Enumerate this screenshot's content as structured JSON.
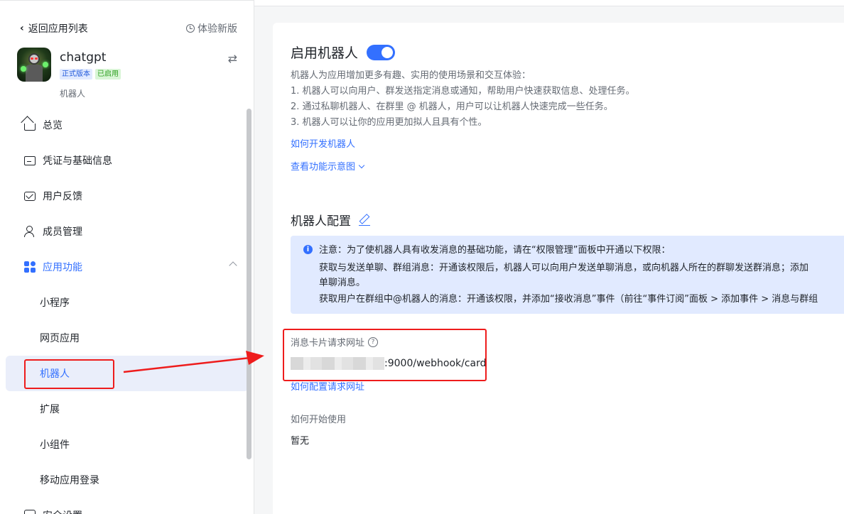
{
  "sidebar": {
    "back_label": "返回应用列表",
    "try_new_label": "体验新版",
    "app": {
      "name": "chatgpt",
      "badge_version": "正式版本",
      "badge_status": "已启用",
      "type": "机器人"
    },
    "nav": [
      {
        "label": "总览",
        "icon": "home-icon"
      },
      {
        "label": "凭证与基础信息",
        "icon": "credential-icon"
      },
      {
        "label": "用户反馈",
        "icon": "feedback-icon"
      },
      {
        "label": "成员管理",
        "icon": "member-icon"
      },
      {
        "label": "应用功能",
        "icon": "grid-icon",
        "expanded": true
      },
      {
        "label": "小程序"
      },
      {
        "label": "网页应用"
      },
      {
        "label": "机器人",
        "active": true
      },
      {
        "label": "扩展"
      },
      {
        "label": "小组件"
      },
      {
        "label": "移动应用登录"
      },
      {
        "label": "安全设置",
        "icon": "shield-icon"
      }
    ]
  },
  "main": {
    "title": "启用机器人",
    "toggle_on": true,
    "desc": [
      "机器人为应用增加更多有趣、实用的使用场景和交互体验：",
      "1. 机器人可以向用户、群发送指定消息或通知，帮助用户快速获取信息、处理任务。",
      "2. 通过私聊机器人、在群里 @ 机器人，用户可以让机器人快速完成一些任务。",
      "3. 机器人可以让你的应用更加拟人且具有个性。"
    ],
    "dev_link": "如何开发机器人",
    "preview_link": "查看功能示意图",
    "config_title": "机器人配置",
    "notice": {
      "line1": "注意：为了使机器人具有收发消息的基础功能，请在“权限管理”面板中开通以下权限：",
      "line2": "获取与发送单聊、群组消息：开通该权限后，机器人可以向用户发送单聊消息，或向机器人所在的群聊发送群消息；添加",
      "line3": "单聊消息。",
      "line4": "获取用户在群组中@机器人的消息：开通该权限，并添加“接收消息”事件（前往“事件订阅”面板 > 添加事件 > 消息与群组"
    },
    "card_url_label": "消息卡片请求网址",
    "card_url_value": ":9000/webhook/card",
    "config_url_link": "如何配置请求网址",
    "start_label": "如何开始使用",
    "start_value": "暂无"
  },
  "colors": {
    "accent": "#3370ff",
    "annotation": "#ee1c1c",
    "notice_bg": "#e1eaff"
  }
}
